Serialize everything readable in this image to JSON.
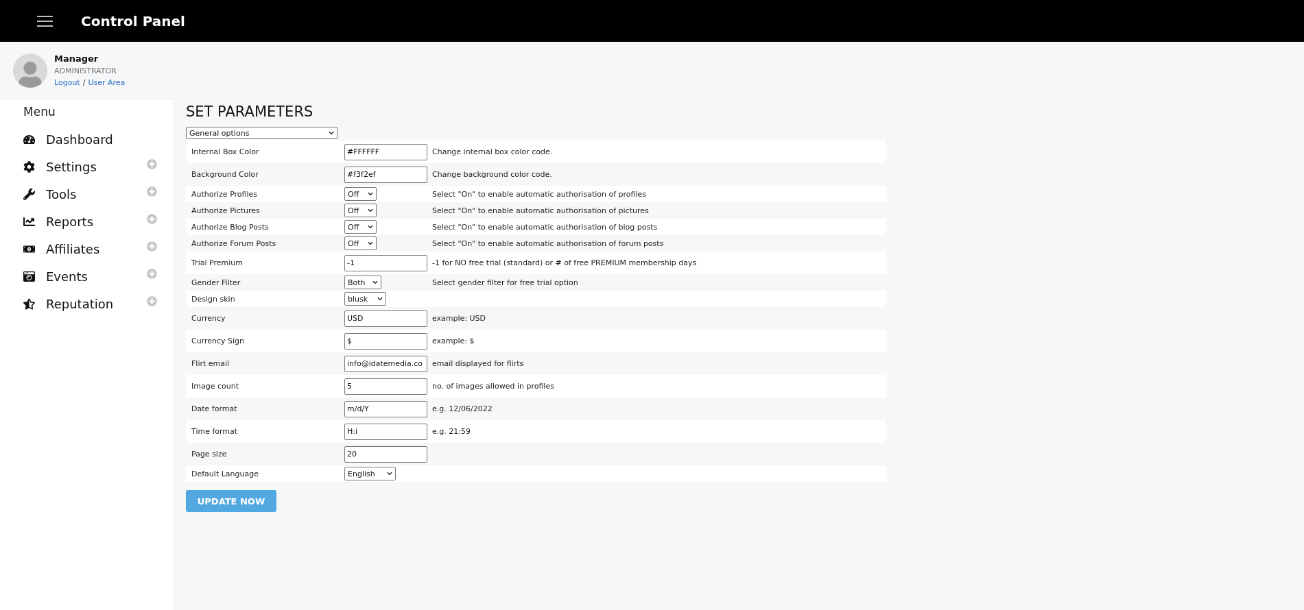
{
  "header": {
    "title": "Control Panel"
  },
  "user": {
    "name": "Manager",
    "role": "ADMINISTRATOR",
    "links": [
      "Logout",
      "User Area"
    ],
    "separator": "/"
  },
  "sidebar": {
    "heading": "Menu",
    "items": [
      {
        "label": "Dashboard",
        "expandable": false
      },
      {
        "label": "Settings",
        "expandable": true
      },
      {
        "label": "Tools",
        "expandable": true
      },
      {
        "label": "Reports",
        "expandable": true
      },
      {
        "label": "Affiliates",
        "expandable": true
      },
      {
        "label": "Events",
        "expandable": true
      },
      {
        "label": "Reputation",
        "expandable": true
      }
    ]
  },
  "page": {
    "title": "SET PARAMETERS",
    "section_select": "General options"
  },
  "rows": [
    {
      "label": "Internal Box Color",
      "kind": "input",
      "value": "#FFFFFF",
      "hint": "Change internal box color code."
    },
    {
      "label": "Background Color",
      "kind": "input",
      "value": "#f3f2ef",
      "hint": "Change background color code."
    },
    {
      "label": "Authorize Profiles",
      "kind": "select",
      "value": "Off",
      "hint": "Select \"On\" to enable automatic authorisation of profiles"
    },
    {
      "label": "Authorize Pictures",
      "kind": "select",
      "value": "Off",
      "hint": "Select \"On\" to enable automatic authorisation of pictures"
    },
    {
      "label": "Authorize Blog Posts",
      "kind": "select",
      "value": "Off",
      "hint": "Select \"On\" to enable automatic authorisation of blog posts"
    },
    {
      "label": "Authorize Forum Posts",
      "kind": "select",
      "value": "Off",
      "hint": "Select \"On\" to enable automatic authorisation of forum posts"
    },
    {
      "label": "Trial Premium",
      "kind": "input",
      "value": "-1",
      "hint": "-1 for NO free trial (standard) or # of free PREMIUM membership days"
    },
    {
      "label": "Gender Filter",
      "kind": "select",
      "value": "Both",
      "hint": "Select gender filter for free trial option"
    },
    {
      "label": "Design skin",
      "kind": "select",
      "value": "blusk"
    },
    {
      "label": "Currency",
      "kind": "input",
      "value": "USD",
      "hint": "example: USD"
    },
    {
      "label": "Currency Sign",
      "kind": "input",
      "value": "$",
      "hint": "example: $"
    },
    {
      "label": "Flirt email",
      "kind": "input",
      "value": "info@idatemedia.co",
      "hint": "email displayed for flirts"
    },
    {
      "label": "Image count",
      "kind": "input",
      "value": "5",
      "hint": "no. of images allowed in profiles"
    },
    {
      "label": "Date format",
      "kind": "input",
      "value": "m/d/Y",
      "hint": "e.g. 12/06/2022"
    },
    {
      "label": "Time format",
      "kind": "input",
      "value": "H:i",
      "hint": "e.g. 21:59"
    },
    {
      "label": "Page size",
      "kind": "input",
      "value": "20"
    },
    {
      "label": "Default Language",
      "kind": "select",
      "value": "English"
    }
  ],
  "submit": "UPDATE NOW"
}
